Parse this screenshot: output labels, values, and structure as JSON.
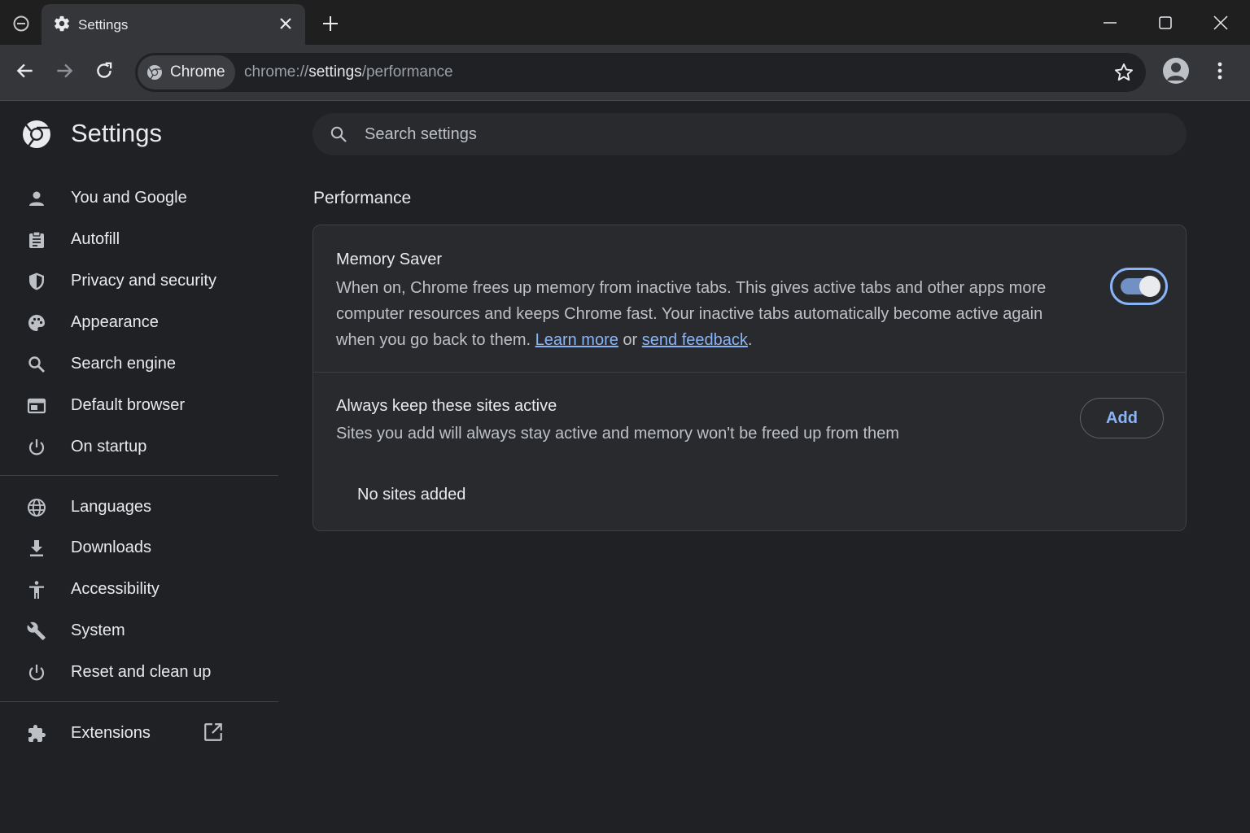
{
  "tabstrip": {
    "tab_title": "Settings"
  },
  "toolbar": {
    "chip_label": "Chrome",
    "url_scheme": "chrome://",
    "url_host": "settings",
    "url_path": "/performance"
  },
  "sidebar": {
    "title": "Settings",
    "groups": [
      [
        {
          "label": "You and Google",
          "icon": "person-icon"
        },
        {
          "label": "Autofill",
          "icon": "clipboard-icon"
        },
        {
          "label": "Privacy and security",
          "icon": "shield-icon"
        },
        {
          "label": "Appearance",
          "icon": "palette-icon"
        },
        {
          "label": "Search engine",
          "icon": "search-icon"
        },
        {
          "label": "Default browser",
          "icon": "browser-icon"
        },
        {
          "label": "On startup",
          "icon": "power-icon"
        }
      ],
      [
        {
          "label": "Languages",
          "icon": "globe-icon"
        },
        {
          "label": "Downloads",
          "icon": "download-icon"
        },
        {
          "label": "Accessibility",
          "icon": "accessibility-icon"
        },
        {
          "label": "System",
          "icon": "wrench-icon"
        },
        {
          "label": "Reset and clean up",
          "icon": "restore-icon"
        }
      ],
      [
        {
          "label": "Extensions",
          "icon": "puzzle-icon"
        }
      ]
    ]
  },
  "search": {
    "placeholder": "Search settings"
  },
  "main": {
    "section_title": "Performance",
    "memory_saver": {
      "title": "Memory Saver",
      "desc_part1": "When on, Chrome frees up memory from inactive tabs. This gives active tabs and other apps more computer resources and keeps Chrome fast. Your inactive tabs automatically become active again when you go back to them. ",
      "learn_more": "Learn more",
      "or": " or ",
      "send_feedback": "send feedback",
      "period": ".",
      "enabled": true
    },
    "keep_active": {
      "title": "Always keep these sites active",
      "description": "Sites you add will always stay active and memory won't be freed up from them",
      "add_label": "Add",
      "empty_text": "No sites added"
    }
  },
  "colors": {
    "accent": "#8ab4f8",
    "background": "#202124",
    "card": "#292a2d"
  }
}
